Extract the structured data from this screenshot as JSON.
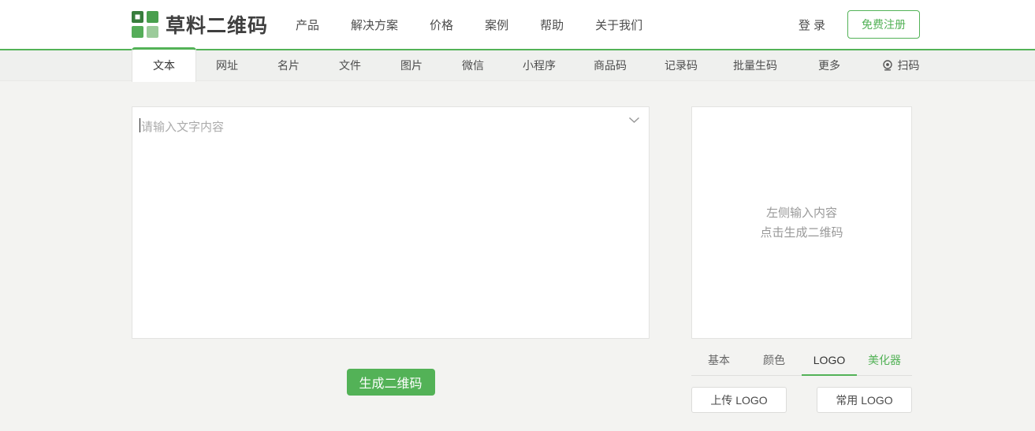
{
  "colors": {
    "accent_green": "#53b257",
    "logo_dark_green": "#377d3c",
    "logo_mid_green": "#49a04e",
    "logo_light_green": "#9bcb9a"
  },
  "header": {
    "logo_text": "草料二维码",
    "nav": [
      {
        "label": "产品"
      },
      {
        "label": "解决方案"
      },
      {
        "label": "价格"
      },
      {
        "label": "案例"
      },
      {
        "label": "帮助"
      },
      {
        "label": "关于我们"
      }
    ],
    "login_label": "登 录",
    "register_label": "免费注册"
  },
  "tabbar": {
    "tabs": [
      {
        "label": "文本",
        "active": true
      },
      {
        "label": "网址"
      },
      {
        "label": "名片"
      },
      {
        "label": "文件"
      },
      {
        "label": "图片"
      },
      {
        "label": "微信"
      },
      {
        "label": "小程序"
      },
      {
        "label": "商品码"
      },
      {
        "label": "记录码"
      },
      {
        "label": "批量生码"
      },
      {
        "label": "更多"
      }
    ],
    "scan_label": "扫码"
  },
  "generator": {
    "input_placeholder": "请输入文字内容",
    "generate_button_label": "生成二维码"
  },
  "preview": {
    "placeholder_line1": "左侧输入内容",
    "placeholder_line2": "点击生成二维码",
    "style_tabs": [
      {
        "label": "基本"
      },
      {
        "label": "颜色"
      },
      {
        "label": "LOGO",
        "active": true
      },
      {
        "label": "美化器",
        "highlight": true
      }
    ],
    "upload_logo_label": "上传 LOGO",
    "common_logo_label": "常用 LOGO"
  }
}
